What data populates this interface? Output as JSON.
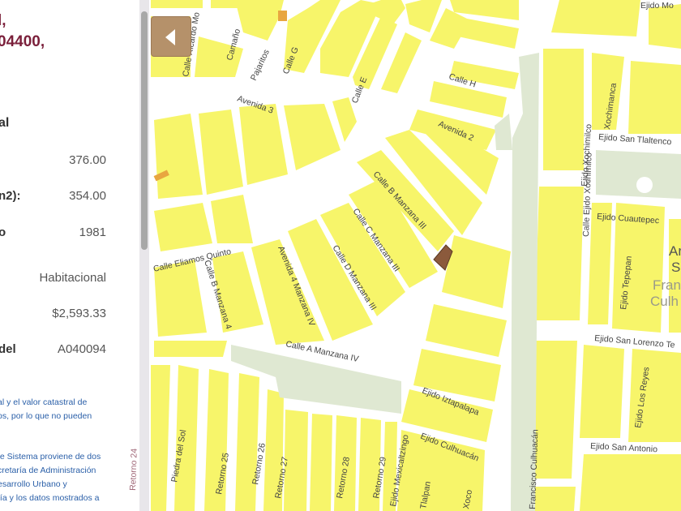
{
  "panel": {
    "address_line1": "l,",
    "address_line2": "04400,",
    "section_title": "al",
    "rows": [
      {
        "label": "",
        "value": "376.00"
      },
      {
        "label": "n2):",
        "value": "354.00"
      },
      {
        "label": "o",
        "value": "1981"
      },
      {
        "label": "",
        "value": "Habitacional"
      },
      {
        "label": "",
        "value": "$2,593.33"
      },
      {
        "label": "del",
        "value": "A040094"
      }
    ],
    "note1": [
      "al y el valor catastral de",
      "os, por lo que no pueden"
    ],
    "note2": [
      "te Sistema proviene de dos",
      "cretaría de Administración",
      "esarrollo Urbano y",
      "fía y los datos mostrados a"
    ]
  },
  "map": {
    "toggle_icon": "triangle-left-icon",
    "colors": {
      "block": "#f7f56a",
      "road": "#ffffff",
      "park": "#dfe8d2",
      "selected": "#8b5a3c",
      "panel_bg": "#8a3a4e"
    },
    "streets": [
      "Avenida 3",
      "Avenida 2",
      "Calle H",
      "Calle G",
      "Calle E",
      "Calle Ricardo Mo",
      "Camaño",
      "Pajaritos",
      "Calle B Manzana III",
      "Calle C Manzana III",
      "Calle D Manzana III",
      "Avenida 4 Manzana IV",
      "Calle B Manzana 4",
      "Calle Eliamos Quinto",
      "Calle A Manzana IV",
      "Ejido Iztapalapa",
      "Ejido Culhuacán",
      "Ejido Mexicaltzingo",
      "Tlalpan",
      "Xoco",
      "Retorno 25",
      "Retorno 26",
      "Retorno 27",
      "Retorno 28",
      "Retorno 29",
      "Retorno 24",
      "Piedra del Sol",
      "Ejido San Tlaltenco",
      "Ejido Cuautepec",
      "Ejido San Lorenzo Te",
      "Ejido San Antonio",
      "Ejido Los Reyes",
      "Ejido Xochimilco",
      "Xochimanca",
      "Ejido Tepepan",
      "Calle Ejido Xochimilco",
      "Francisco Culhuacán",
      "Ejido Mo"
    ],
    "place_labels": [
      "Fran",
      "Culh",
      "Ar",
      "S"
    ]
  }
}
